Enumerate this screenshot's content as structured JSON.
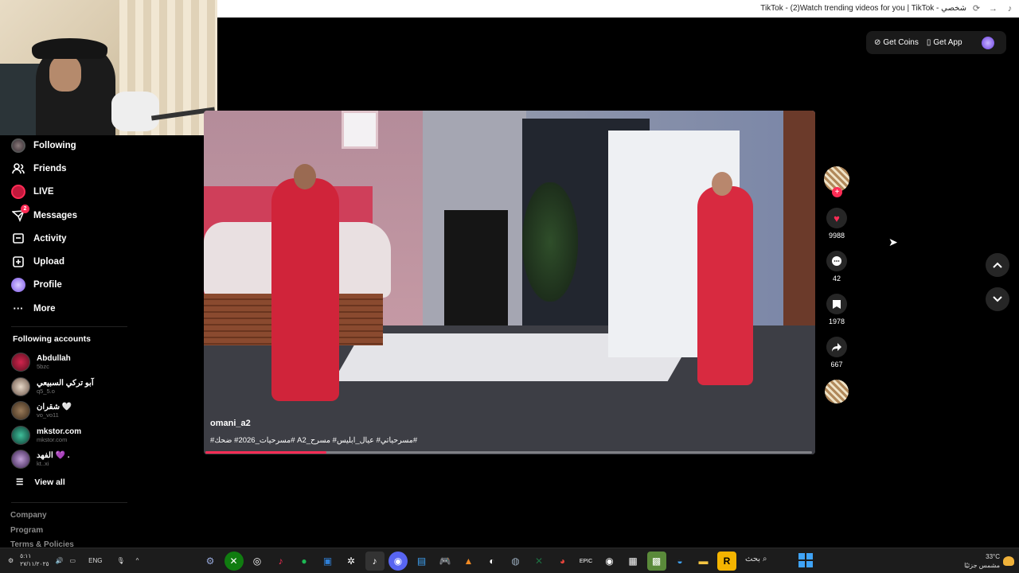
{
  "browser": {
    "title": "TikTok - (2)Watch trending videos for you | TikTok - شخصي"
  },
  "topbar": {
    "get_coins": "Get Coins",
    "get_app": "Get App"
  },
  "sidebar": {
    "items": [
      {
        "label": "Following",
        "icon": "following-avatar-icon"
      },
      {
        "label": "Friends",
        "icon": "friends-icon"
      },
      {
        "label": "LIVE",
        "icon": "live-icon"
      },
      {
        "label": "Messages",
        "icon": "messages-icon",
        "badge": "2"
      },
      {
        "label": "Activity",
        "icon": "activity-icon"
      },
      {
        "label": "Upload",
        "icon": "upload-icon"
      },
      {
        "label": "Profile",
        "icon": "profile-icon"
      },
      {
        "label": "More",
        "icon": "more-icon"
      }
    ],
    "following_title": "Following accounts",
    "accounts": [
      {
        "name": "Abdullah",
        "handle": "5bzc"
      },
      {
        "name": "آبو تركي السبيعي",
        "handle": "q5_5.o"
      },
      {
        "name": "شقران 🤍",
        "handle": "vo_vo11"
      },
      {
        "name": "mkstor.com",
        "handle": "mkstor.com"
      },
      {
        "name": "الفهد 💜 .",
        "handle": "kt..xi"
      }
    ],
    "view_all": "View all",
    "footer": [
      "Company",
      "Program",
      "Terms & Policies"
    ]
  },
  "video": {
    "username": "omani_a2",
    "tags": "#مسرحيات_2026# ضحك# A2_مسرحياتي# عيال_ابليس# مسرح#",
    "progress": 0.2
  },
  "actions": {
    "likes": "9988",
    "comments": "42",
    "saves": "1978",
    "shares": "667"
  },
  "taskbar": {
    "lang": "ENG",
    "time": "٥:١١",
    "date": "٢٧/١١/٢٠٢٥",
    "search": "بحث",
    "temp": "33°C",
    "weather": "مشمس جزئيًا"
  }
}
